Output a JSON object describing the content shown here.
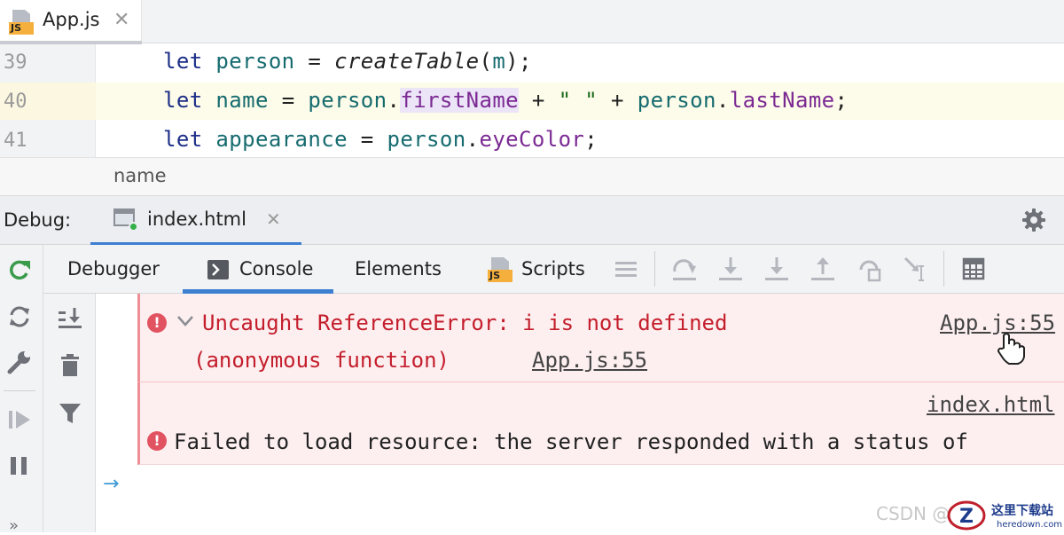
{
  "editor": {
    "tab": {
      "label": "App.js",
      "icon": "js-file-icon",
      "badge": "JS"
    },
    "lines": [
      {
        "number": "39",
        "tokens": [
          "let",
          "person",
          "=",
          "createTable",
          "(",
          "m",
          ");"
        ]
      },
      {
        "number": "40",
        "tokens": [
          "let",
          "name",
          "=",
          "person",
          ".",
          "firstName",
          "+",
          "\" \"",
          "+",
          "person",
          ".",
          "lastName",
          ";"
        ]
      },
      {
        "number": "41",
        "tokens": [
          "let",
          "appearance",
          "=",
          "person",
          ".",
          "eyeColor",
          ";"
        ]
      }
    ],
    "breadcrumb": "name"
  },
  "debug": {
    "label": "Debug:",
    "session_tab": {
      "label": "index.html",
      "icon": "html-run-icon"
    },
    "settings_icon": "gear-icon",
    "tabs": [
      {
        "label": "Debugger"
      },
      {
        "label": "Console",
        "active": true
      },
      {
        "label": "Elements"
      },
      {
        "label": "Scripts",
        "badge": "JS"
      }
    ]
  },
  "console": {
    "errors": [
      {
        "message": "Uncaught ReferenceError: i is not defined",
        "source": "App.js:55",
        "stack": [
          {
            "frame": "(anonymous function)",
            "source": "App.js:55"
          }
        ]
      },
      {
        "message": "Failed to load resource: the server responded with a status of",
        "source": "index.html"
      }
    ],
    "prompt": "→"
  },
  "watermark": {
    "text": "CSDN @",
    "logo_text": "这里下载站",
    "logo_sub": "heredown.com"
  },
  "colors": {
    "accent": "#3d7fd0",
    "error_bg": "#fdeff0",
    "error_text": "#c41e2c",
    "keyword": "#1d2f88",
    "variable": "#166b6f",
    "property": "#7b2a93"
  }
}
